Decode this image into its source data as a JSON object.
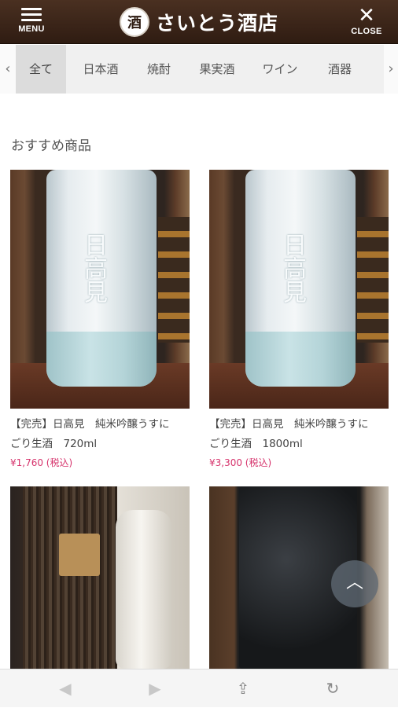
{
  "header": {
    "menu_label": "MENU",
    "close_label": "CLOSE",
    "logo_glyph": "酒",
    "shop_name": "さいとう酒店"
  },
  "tabs": {
    "left_arrow": "‹",
    "right_arrow": "›",
    "items": [
      {
        "label": "全て",
        "active": true
      },
      {
        "label": "日本酒"
      },
      {
        "label": "焼酎"
      },
      {
        "label": "果実酒"
      },
      {
        "label": "ワイン"
      },
      {
        "label": "酒器"
      }
    ]
  },
  "section": {
    "title": "おすすめ商品"
  },
  "products": [
    {
      "name_line1": "【完売】日高見　純米吟醸うすに",
      "name_line2": "ごり生酒　720ml",
      "price": "¥1,760 (税込)",
      "bottle_text": "日高見"
    },
    {
      "name_line1": "【完売】日高見　純米吟醸うすに",
      "name_line2": "ごり生酒　1800ml",
      "price": "¥3,300 (税込)",
      "bottle_text": "日高見"
    },
    {
      "name_line1": "",
      "name_line2": "",
      "price": ""
    },
    {
      "name_line1": "",
      "name_line2": "",
      "price": ""
    }
  ],
  "scroll_top": {
    "icon": "chevron-up-icon",
    "glyph": "︿"
  },
  "toolbar": {
    "back_glyph": "◀",
    "forward_glyph": "▶",
    "share_glyph": "⇪",
    "reload_glyph": "↻"
  },
  "colors": {
    "header_bg": "#3b2518",
    "price": "#d6336c",
    "active_tab": "#dcdcdc"
  }
}
